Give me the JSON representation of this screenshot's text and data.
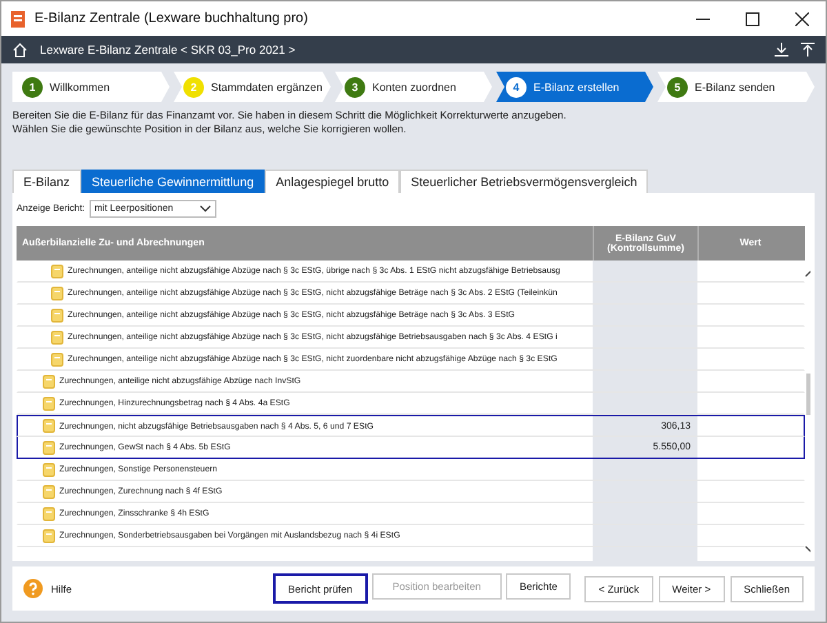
{
  "window": {
    "title": "E-Bilanz Zentrale (Lexware buchhaltung pro)"
  },
  "nav": {
    "breadcrumb": "Lexware E-Bilanz Zentrale < SKR 03_Pro 2021 >"
  },
  "steps": [
    {
      "number": "1",
      "label": "Willkommen",
      "color": "#3f7a12",
      "selected": false
    },
    {
      "number": "2",
      "label": "Stammdaten ergänzen",
      "color": "#f0e000",
      "selected": false
    },
    {
      "number": "3",
      "label": "Konten zuordnen",
      "color": "#3f7a12",
      "selected": false
    },
    {
      "number": "4",
      "label": "E-Bilanz erstellen",
      "color": "#ffffff",
      "selected": true
    },
    {
      "number": "5",
      "label": "E-Bilanz senden",
      "color": "#3f7a12",
      "selected": false
    }
  ],
  "description": [
    "Bereiten Sie die E-Bilanz für das Finanzamt vor. Sie haben in diesem Schritt die Möglichkeit Korrekturwerte anzugeben.",
    "Wählen Sie die gewünschte Position in der Bilanz aus, welche Sie korrigieren wollen."
  ],
  "tabs": [
    {
      "label": "E-Bilanz",
      "selected": false
    },
    {
      "label": "Steuerliche Gewinnermittlung",
      "selected": true
    },
    {
      "label": "Anlagespiegel brutto",
      "selected": false
    },
    {
      "label": "Steuerlicher Betriebsvermögensvergleich",
      "selected": false
    }
  ],
  "filter": {
    "label": "Anzeige Bericht:",
    "value": "mit Leerpositionen"
  },
  "table": {
    "columns": [
      "Außerbilanzielle Zu- und Abrechnungen",
      "E-Bilanz GuV (Kontrollsumme)",
      "Wert"
    ],
    "rows": [
      {
        "children": [
          {
            "label": "Zurechnungen, anteilige nicht abzugsfähige Abzüge nach § 3c EStG, übrige nach § 3c Abs. 1 EStG nicht abzugsfähige Betriebsausg",
            "selected": false
          },
          {
            "label": "Zurechnungen, anteilige nicht abzugsfähige Abzüge nach § 3c EStG, nicht abzugsfähige Beträge nach § 3c Abs. 2 EStG (Teileinkün",
            "selected": false
          },
          {
            "label": "Zurechnungen, anteilige nicht abzugsfähige Abzüge nach § 3c EStG, nicht abzugsfähige Beträge nach § 3c Abs. 3 EStG",
            "selected": false
          },
          {
            "label": "Zurechnungen, anteilige nicht abzugsfähige Abzüge nach § 3c EStG, nicht abzugsfähige Betriebsausgaben nach § 3c Abs. 4 EStG i",
            "selected": false
          },
          {
            "label": "Zurechnungen, anteilige nicht abzugsfähige Abzüge nach § 3c EStG, nicht zuordenbare nicht abzugsfähige Abzüge nach § 3c EStG",
            "selected": false
          }
        ]
      },
      {
        "label": "Zurechnungen, anteilige nicht abzugsfähige Abzüge nach InvStG",
        "selected": false
      },
      {
        "label": "Zurechnungen, Hinzurechnungsbetrag nach § 4 Abs. 4a EStG",
        "selected": false
      },
      {
        "label": "Zurechnungen, nicht abzugsfähige Betriebsausgaben nach § 4 Abs. 5, 6 und 7 EStG",
        "guv": "306,13",
        "selected": true
      },
      {
        "label": "Zurechnungen, GewSt nach § 4 Abs. 5b EStG",
        "guv": "5.550,00",
        "selected": true
      },
      {
        "label": "Zurechnungen, Sonstige Personensteuern",
        "selected": false
      },
      {
        "label": "Zurechnungen, Zurechnung nach § 4f EStG",
        "selected": false
      },
      {
        "label": "Zurechnungen, Zinsschranke § 4h EStG",
        "selected": false
      },
      {
        "label": "Zurechnungen, Sonderbetriebsausgaben bei Vorgängen mit Auslandsbezug nach § 4i EStG",
        "selected": false
      }
    ]
  },
  "footer": {
    "help": "Hilfe",
    "buttons": [
      {
        "label": "Bericht prüfen",
        "focused": true,
        "disabled": false
      },
      {
        "label": "Position bearbeiten",
        "focused": false,
        "disabled": true
      },
      {
        "label": "Berichte",
        "focused": false,
        "disabled": false
      }
    ],
    "nav_buttons": [
      "< Zurück",
      "Weiter >",
      "Schließen"
    ]
  }
}
